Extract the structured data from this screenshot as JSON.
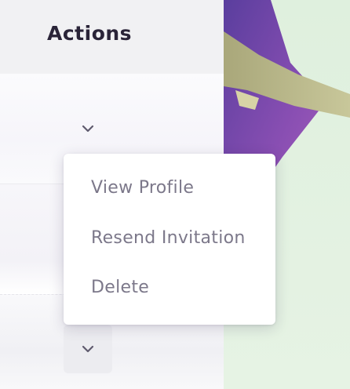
{
  "table": {
    "column_header": "Actions"
  },
  "dropdown": {
    "items": [
      {
        "label": "View Profile"
      },
      {
        "label": "Resend Invitation"
      },
      {
        "label": "Delete"
      }
    ]
  },
  "icons": {
    "row_toggle": "chevron-down-icon"
  },
  "colors": {
    "header_text": "#2a2438",
    "menu_text": "#7c788a",
    "art_purple": "#7b4fb0",
    "art_olive": "#b8b584",
    "art_mint": "#dff0de"
  }
}
